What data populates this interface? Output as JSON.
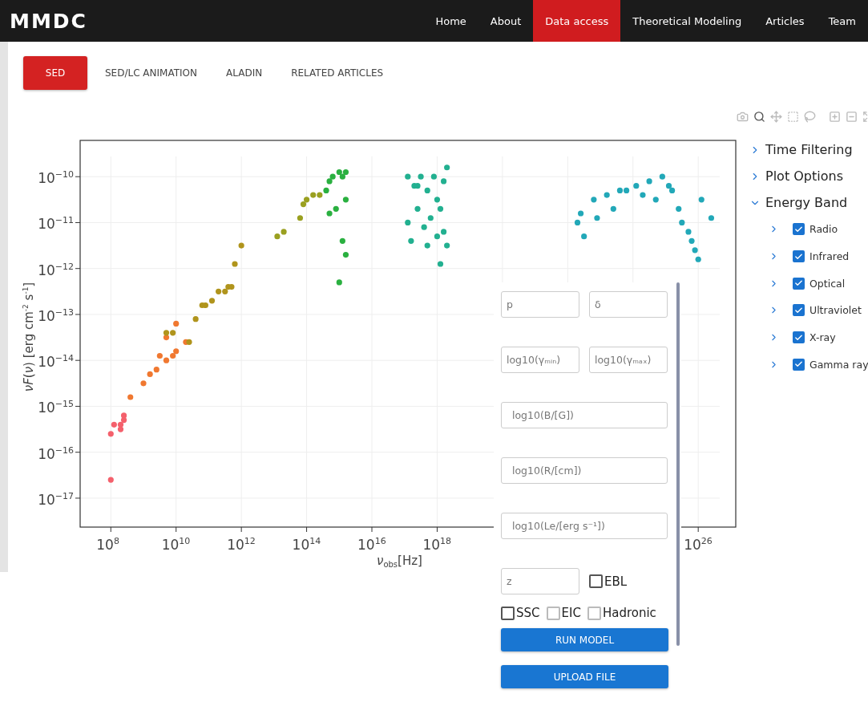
{
  "navbar": {
    "brand": "MMDC",
    "links": [
      {
        "label": "Home",
        "selected": false
      },
      {
        "label": "About",
        "selected": false
      },
      {
        "label": "Data access",
        "selected": true
      },
      {
        "label": "Theoretical Modeling",
        "selected": false
      },
      {
        "label": "Articles",
        "selected": false
      },
      {
        "label": "Team",
        "selected": false
      }
    ]
  },
  "tabs": [
    {
      "label": "SED",
      "selected": true
    },
    {
      "label": "SED/LC ANIMATION",
      "selected": false
    },
    {
      "label": "ALADIN",
      "selected": false
    },
    {
      "label": "RELATED ARTICLES",
      "selected": false
    }
  ],
  "plot_toolbar": [
    {
      "kind": "camera",
      "selected": false
    },
    {
      "kind": "zoom",
      "selected": true
    },
    {
      "kind": "pan",
      "selected": false
    },
    {
      "kind": "box-select",
      "selected": false
    },
    {
      "kind": "lasso",
      "selected": false
    },
    {
      "kind": "zoom-in",
      "selected": false
    },
    {
      "kind": "zoom-out",
      "selected": false
    },
    {
      "kind": "autoscale",
      "selected": false
    }
  ],
  "plot": {
    "x_axis": {
      "title": "*ν*$_{obs}$[Hz]",
      "tick_labels": [
        "10$^{8}$",
        "10$^{10}$",
        "10$^{12}$",
        "10$^{14}$",
        "10$^{16}$",
        "10$^{18}$",
        "10$^{26}$"
      ]
    },
    "y_axis": {
      "title": "*νF*(*ν*) [erg cm$^{-2}$ s$^{-1}$]",
      "tick_labels": [
        "10$^{−10}$",
        "10$^{−11}$",
        "10$^{−12}$",
        "10$^{−13}$",
        "10$^{−14}$",
        "10$^{−15}$",
        "10$^{−16}$",
        "10$^{−17}$"
      ]
    }
  },
  "filter_tree": [
    {
      "label": "Time Filtering",
      "expanded": false
    },
    {
      "label": "Plot Options",
      "expanded": false
    },
    {
      "label": "Energy Band",
      "expanded": true,
      "children": [
        {
          "label": "Radio",
          "expanded": false,
          "checked": true
        },
        {
          "label": "Infrared",
          "expanded": false,
          "checked": true
        },
        {
          "label": "Optical",
          "expanded": false,
          "checked": true
        },
        {
          "label": "Ultraviolet",
          "expanded": false,
          "checked": true
        },
        {
          "label": "X-ray",
          "expanded": false,
          "checked": true
        },
        {
          "label": "Gamma ray",
          "expanded": false,
          "checked": true
        }
      ]
    }
  ],
  "model_form": {
    "rows": [
      {
        "items": [
          {
            "kind": "field",
            "placeholder": "p"
          },
          {
            "kind": "field",
            "placeholder": "δ"
          }
        ]
      },
      {
        "items": [
          {
            "kind": "field",
            "placeholder": "log10(γₘᵢₙ)"
          },
          {
            "kind": "field",
            "placeholder": "log10(γₘₐₓ)"
          }
        ]
      },
      {
        "items": [
          {
            "kind": "field",
            "placeholder": "log10(B/[G])"
          }
        ]
      },
      {
        "items": [
          {
            "kind": "field",
            "placeholder": "log10(R/[cm])"
          }
        ]
      },
      {
        "items": [
          {
            "kind": "field",
            "placeholder": "log10(Le/[erg s⁻¹])"
          }
        ]
      },
      {
        "items": [
          {
            "kind": "field",
            "placeholder": "z"
          },
          {
            "kind": "checkbox",
            "label": "EBL",
            "checked": false,
            "disabled": false
          }
        ]
      },
      {
        "items": [
          {
            "kind": "checkbox",
            "label": "SSC",
            "checked": false,
            "disabled": false
          },
          {
            "kind": "checkbox",
            "label": "EIC",
            "checked": false,
            "disabled": true
          },
          {
            "kind": "checkbox",
            "label": "Hadronic",
            "checked": false,
            "disabled": true
          }
        ]
      }
    ],
    "buttons": [
      "RUN MODEL",
      "UPLOAD FILE"
    ]
  }
}
